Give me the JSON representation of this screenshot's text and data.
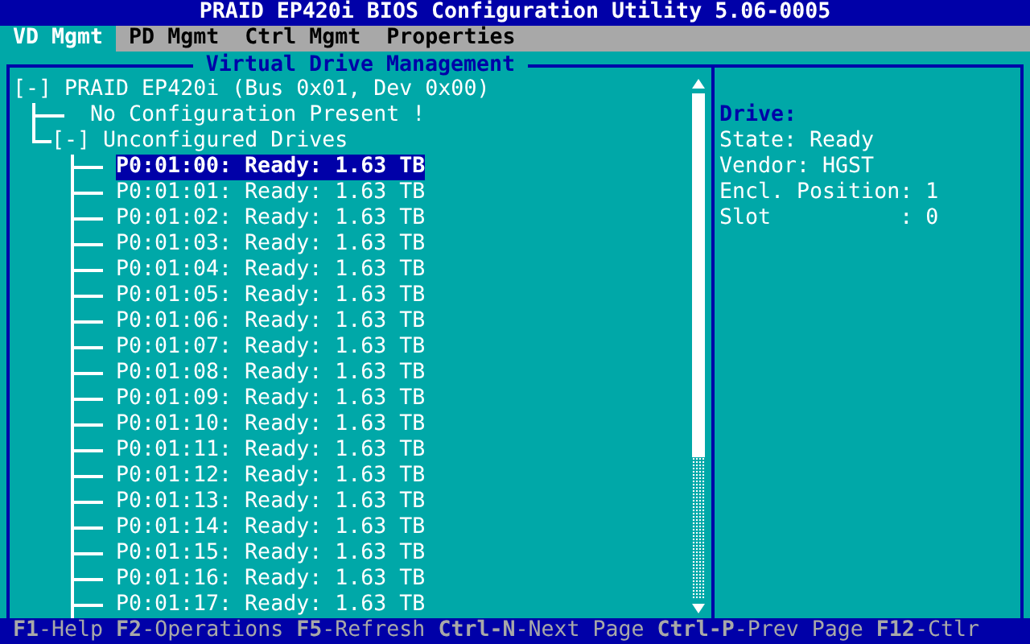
{
  "window": {
    "title": "PRAID EP420i BIOS Configuration Utility 5.06-0005"
  },
  "tabs": [
    {
      "label": "VD Mgmt",
      "selected": true
    },
    {
      "label": "PD Mgmt",
      "selected": false
    },
    {
      "label": "Ctrl Mgmt",
      "selected": false
    },
    {
      "label": "Properties",
      "selected": false
    }
  ],
  "panel": {
    "title": "Virtual Drive Management"
  },
  "tree": {
    "label": "[-] PRAID EP420i (Bus 0x01, Dev 0x00)",
    "expanded": true,
    "children": [
      {
        "label": "No Configuration Present !"
      },
      {
        "label": "[-] Unconfigured Drives",
        "expanded": true,
        "children": [
          {
            "label": "P0:01:00: Ready: 1.63 TB",
            "selected": true
          },
          {
            "label": "P0:01:01: Ready: 1.63 TB",
            "selected": false
          },
          {
            "label": "P0:01:02: Ready: 1.63 TB",
            "selected": false
          },
          {
            "label": "P0:01:03: Ready: 1.63 TB",
            "selected": false
          },
          {
            "label": "P0:01:04: Ready: 1.63 TB",
            "selected": false
          },
          {
            "label": "P0:01:05: Ready: 1.63 TB",
            "selected": false
          },
          {
            "label": "P0:01:06: Ready: 1.63 TB",
            "selected": false
          },
          {
            "label": "P0:01:07: Ready: 1.63 TB",
            "selected": false
          },
          {
            "label": "P0:01:08: Ready: 1.63 TB",
            "selected": false
          },
          {
            "label": "P0:01:09: Ready: 1.63 TB",
            "selected": false
          },
          {
            "label": "P0:01:10: Ready: 1.63 TB",
            "selected": false
          },
          {
            "label": "P0:01:11: Ready: 1.63 TB",
            "selected": false
          },
          {
            "label": "P0:01:12: Ready: 1.63 TB",
            "selected": false
          },
          {
            "label": "P0:01:13: Ready: 1.63 TB",
            "selected": false
          },
          {
            "label": "P0:01:14: Ready: 1.63 TB",
            "selected": false
          },
          {
            "label": "P0:01:15: Ready: 1.63 TB",
            "selected": false
          },
          {
            "label": "P0:01:16: Ready: 1.63 TB",
            "selected": false
          },
          {
            "label": "P0:01:17: Ready: 1.63 TB",
            "selected": false
          }
        ]
      }
    ]
  },
  "details": {
    "heading": "Drive:",
    "lines": [
      "State: Ready",
      "Vendor: HGST",
      "Encl. Position: 1",
      "Slot          : 0"
    ]
  },
  "status_bar": [
    "**F1**-Help",
    "**F2**-Operations",
    "**F5**-Refresh",
    "**Ctrl-N**-Next Page",
    "**Ctrl-P**-Prev Page",
    "**F12**-Ctlr"
  ]
}
